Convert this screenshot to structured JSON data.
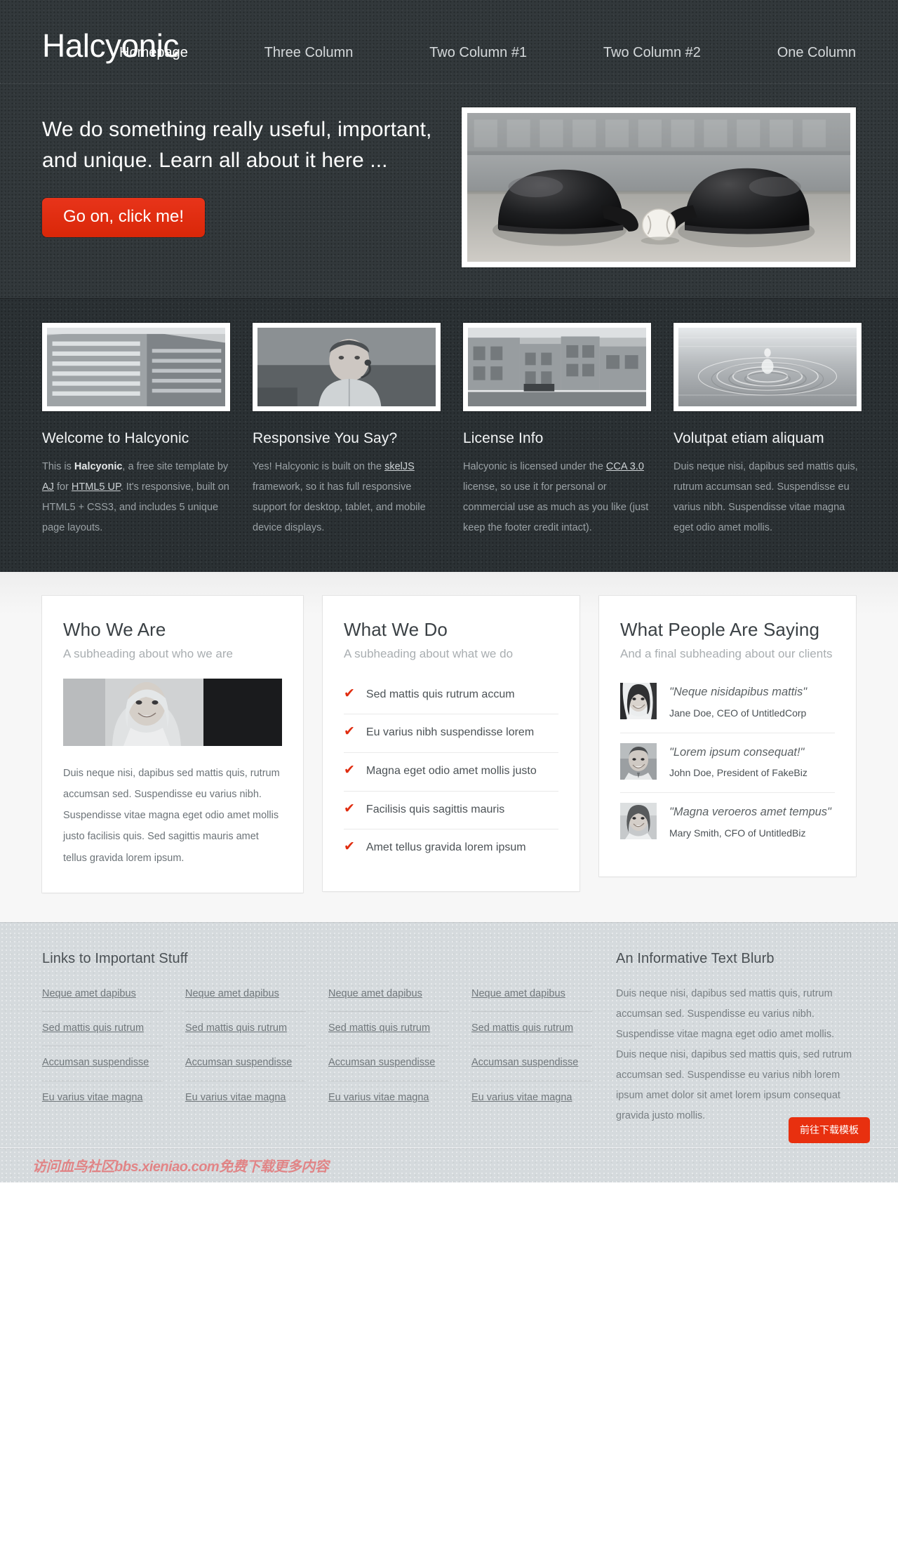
{
  "site": {
    "logo": "Halcyonic",
    "nav": [
      {
        "label": "Homepage",
        "current": true
      },
      {
        "label": "Three Column",
        "current": false
      },
      {
        "label": "Two Column #1",
        "current": false
      },
      {
        "label": "Two Column #2",
        "current": false
      },
      {
        "label": "One Column",
        "current": false
      }
    ]
  },
  "banner": {
    "headline": "We do something really useful, important, and unique. Learn all about it here ...",
    "cta_label": "Go on, click me!",
    "image_alt": "two baseball batting helmets and a baseball on dirt"
  },
  "features": [
    {
      "title": "Welcome to Halcyonic",
      "image_alt": "modern office building facade",
      "text_parts": [
        {
          "t": "This is ",
          "style": "plain"
        },
        {
          "t": "Halcyonic",
          "style": "bold"
        },
        {
          "t": ", a free site template by ",
          "style": "plain"
        },
        {
          "t": "AJ",
          "style": "link"
        },
        {
          "t": " for ",
          "style": "plain"
        },
        {
          "t": "HTML5 UP",
          "style": "link"
        },
        {
          "t": ". It's responsive, built on HTML5 + CSS3, and includes 5 unique page layouts.",
          "style": "plain"
        }
      ]
    },
    {
      "title": "Responsive You Say?",
      "image_alt": "man with headset at a desk",
      "text_parts": [
        {
          "t": "Yes! Halcyonic is built on the ",
          "style": "plain"
        },
        {
          "t": "skelJS",
          "style": "link"
        },
        {
          "t": " framework, so it has full responsive support for desktop, tablet, and mobile device displays.",
          "style": "plain"
        }
      ]
    },
    {
      "title": "License Info",
      "image_alt": "city street with storefronts",
      "text_parts": [
        {
          "t": "Halcyonic is licensed under the ",
          "style": "plain"
        },
        {
          "t": "CCA 3.0",
          "style": "link"
        },
        {
          "t": " license, so use it for personal or commercial use as much as you like (just keep the footer credit intact).",
          "style": "plain"
        }
      ]
    },
    {
      "title": "Volutpat etiam aliquam",
      "image_alt": "water ripples close up",
      "text_parts": [
        {
          "t": "Duis neque nisi, dapibus sed mattis quis, rutrum accumsan sed. Suspendisse eu varius nibh. Suspendisse vitae magna eget odio amet mollis.",
          "style": "plain"
        }
      ]
    }
  ],
  "main": {
    "who_we_are": {
      "title": "Who We Are",
      "subheading": "A subheading about who we are",
      "image_alt": "smiling blonde woman portrait",
      "body": "Duis neque nisi, dapibus sed mattis quis, rutrum accumsan sed. Suspendisse eu varius nibh. Suspendisse vitae magna eget odio amet mollis justo facilisis quis. Sed sagittis mauris amet tellus gravida lorem ipsum."
    },
    "what_we_do": {
      "title": "What We Do",
      "subheading": "A subheading about what we do",
      "items": [
        "Sed mattis quis rutrum accum",
        "Eu varius nibh suspendisse lorem",
        "Magna eget odio amet mollis justo",
        "Facilisis quis sagittis mauris",
        "Amet tellus gravida lorem ipsum"
      ],
      "check_icon": "check-icon",
      "check_color": "#e02d10"
    },
    "testimonials": {
      "title": "What People Are Saying",
      "subheading": "And a final subheading about our clients",
      "items": [
        {
          "quote": "\"Neque nisidapibus mattis\"",
          "attribution": "Jane Doe, CEO of UntitledCorp",
          "avatar_alt": "smiling woman with dark hair"
        },
        {
          "quote": "\"Lorem ipsum consequat!\"",
          "attribution": "John Doe, President of FakeBiz",
          "avatar_alt": "smiling man"
        },
        {
          "quote": "\"Magna veroeros amet tempus\"",
          "attribution": "Mary Smith, CFO of UntitledBiz",
          "avatar_alt": "woman with short hair"
        }
      ]
    }
  },
  "footer": {
    "links_title": "Links to Important Stuff",
    "link_columns": [
      [
        "Neque amet dapibus",
        "Sed mattis quis rutrum",
        "Accumsan suspendisse",
        "Eu varius vitae magna"
      ],
      [
        "Neque amet dapibus",
        "Sed mattis quis rutrum",
        "Accumsan suspendisse",
        "Eu varius vitae magna"
      ],
      [
        "Neque amet dapibus",
        "Sed mattis quis rutrum",
        "Accumsan suspendisse",
        "Eu varius vitae magna"
      ],
      [
        "Neque amet dapibus",
        "Sed mattis quis rutrum",
        "Accumsan suspendisse",
        "Eu varius vitae magna"
      ]
    ],
    "blurb_title": "An Informative Text Blurb",
    "blurb_text": "Duis neque nisi, dapibus sed mattis quis, rutrum accumsan sed. Suspendisse eu varius nibh. Suspendisse vitae magna eget odio amet mollis. Duis neque nisi, dapibus sed mattis quis, sed rutrum accumsan sed. Suspendisse eu varius nibh lorem ipsum amet dolor sit amet lorem ipsum consequat gravida justo mollis.",
    "watermark": "访问血鸟社区bbs.xieniao.com免费下载更多内容",
    "download_button": "前往下载模板"
  },
  "colors": {
    "accent_red": "#e12d10",
    "header_bg": "#32383b",
    "features_bg": "#2b3134",
    "main_bg": "#f4f4f4",
    "footer_bg": "#d5dadd"
  }
}
